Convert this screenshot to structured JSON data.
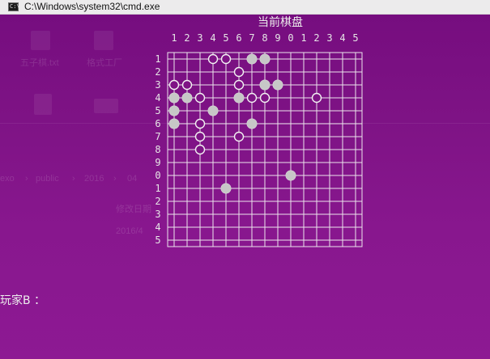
{
  "window": {
    "title": "C:\\Windows\\system32\\cmd.exe",
    "icon": "cmd-console-icon",
    "icon_glyph": "C:\\"
  },
  "console": {
    "header": "当前棋盘",
    "column_labels": [
      "1",
      "2",
      "3",
      "4",
      "5",
      "6",
      "7",
      "8",
      "9",
      "0",
      "1",
      "2",
      "3",
      "4",
      "5"
    ],
    "row_labels": [
      "1",
      "2",
      "3",
      "4",
      "5",
      "6",
      "7",
      "8",
      "9",
      "0",
      "1",
      "2",
      "3",
      "4",
      "5"
    ],
    "board": {
      "size": 15,
      "hollow_stones": [
        [
          1,
          4
        ],
        [
          1,
          5
        ],
        [
          2,
          6
        ],
        [
          3,
          1
        ],
        [
          3,
          2
        ],
        [
          3,
          6
        ],
        [
          4,
          3
        ],
        [
          4,
          7
        ],
        [
          4,
          8
        ],
        [
          4,
          12
        ],
        [
          6,
          3
        ],
        [
          7,
          3
        ],
        [
          7,
          6
        ],
        [
          8,
          3
        ]
      ],
      "filled_stones": [
        [
          1,
          7
        ],
        [
          1,
          8
        ],
        [
          3,
          8
        ],
        [
          3,
          9
        ],
        [
          4,
          1
        ],
        [
          4,
          2
        ],
        [
          4,
          6
        ],
        [
          5,
          1
        ],
        [
          5,
          4
        ],
        [
          6,
          1
        ],
        [
          6,
          7
        ],
        [
          10,
          10
        ],
        [
          11,
          5
        ]
      ]
    },
    "prompt": "玩家B ："
  },
  "colors": {
    "titlebar_bg": "#ecebec",
    "console_bg": "#7e1385",
    "text": "#ececec",
    "grid_line": "#ece4ec",
    "hollow_stone_stroke": "#f2f2f2",
    "filled_stone": "#c7c7c7"
  },
  "background_desktop": {
    "icon_labels": [
      "五子棋.txt",
      "格式工厂"
    ],
    "breadcrumb": [
      "exo",
      "public",
      "2016",
      "04"
    ],
    "column_header": "修改日期",
    "date_fragment": "2016/4"
  }
}
